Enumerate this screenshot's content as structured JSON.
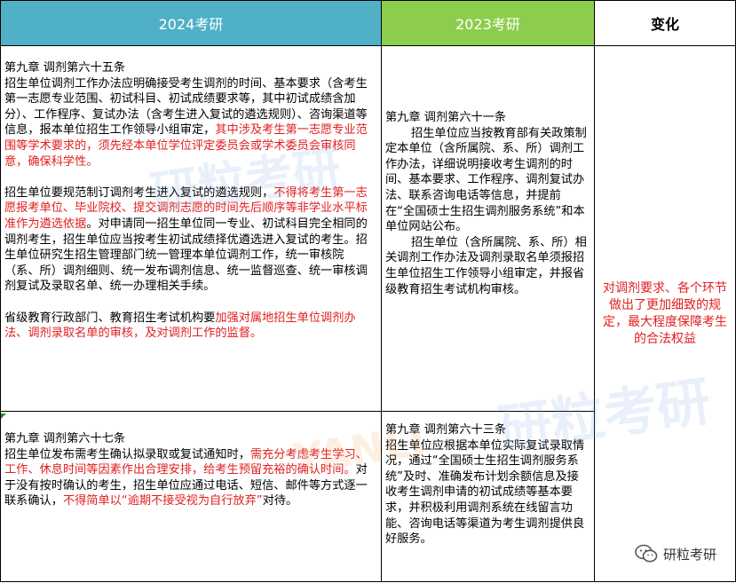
{
  "headers": {
    "col1": "2024考研",
    "col2": "2023考研",
    "col3": "变化"
  },
  "row1": {
    "left": {
      "title": "第九章 调剂第六十五条",
      "p1_plain": "招生单位调剂工作办法应明确接受考生调剂的时间、基本要求（含考生第一志愿专业范围、初试科目、初试成绩要求等，其中初试成绩含加分）、工作程序、复试办法（含考生进入复试的遴选规则）、咨询渠道等信息，报本单位招生工作领导小组审定，",
      "p1_red": "其中涉及考生第一志愿专业范围等学术要求的，须先经本单位学位评定委员会或学术委员会审核同意，确保科学性。",
      "p2_plain_a": "招生单位要规范制订调剂考生进入复试的遴选规则，",
      "p2_red": "不得将考生第一志愿报考单位、毕业院校、提交调剂志愿的时间先后顺序等非学业水平标准作为遴选依据",
      "p2_plain_b": "。对申请同一招生单位同一专业、初试科目完全相同的调剂考生，招生单位应当按考生初试成绩择优遴选进入复试的考生。招生单位研究生招生管理部门统一管理本单位调剂工作，统一审核院（系、所）调剂细则、统一发布调剂信息、统一监督巡查、统一审核调剂复试及录取名单、统一办理相关手续。",
      "p3_plain": "省级教育行政部门、教育招生考试机构要",
      "p3_red": "加强对属地招生单位调剂办法、调剂录取名单的审核，及对调剂工作的监督。"
    },
    "right": {
      "title": "第九章 调剂第六十一条",
      "p1": "招生单位应当按教育部有关政策制定本单位（含所属院、系、所）调剂工作办法，详细说明接收考生调剂的时间、基本要求、工作程序、调剂复试办法、联系咨询电话等信息，并提前在“全国硕士生招生调剂服务系统”和本单位网站公布。",
      "p2": "招生单位（含所属院、系、所）相关调剂工作办法及调剂录取名单须报招生单位招生工作领导小组审定，并报省级教育招生考试机构审核。"
    },
    "change": "对调剂要求、各个环节做出了更加细致的规定，最大程度保障考生的合法权益"
  },
  "row2": {
    "left": {
      "title": "第九章 调剂第六十七条",
      "p1_plain_a": "招生单位发布需考生确认拟录取或复试通知时，",
      "p1_red": "需充分考虑考生学习、工作、休息时间等因素作出合理安排，给考生预留充裕的确认时间。",
      "p1_plain_b": "对于没有按时确认的考生，招生单位应通过电话、短信、邮件等方式逐一联系确认，",
      "p1_red2": "不得简单以“逾期不接受视为自行放弃”",
      "p1_plain_c": "对待。"
    },
    "right": {
      "title": "第九章 调剂第六十三条",
      "p1": "招生单位应根据本单位实际复试录取情况，通过“全国硕士生招生调剂服务系统”及时、准确发布计划余额信息及接收考生调剂申请的初试成绩等基本要求，并积极利用调剂系统在线留言功能、咨询电话等渠道为考生调剂提供良好服务。"
    }
  },
  "watermark": {
    "text_a": "研粒考研",
    "text_b": "研粒考研",
    "text_c": "YANLI"
  },
  "wechat": {
    "icon": "wechat-icon",
    "label": "研粒考研"
  },
  "colors": {
    "header1": "#4fb0c6",
    "header2": "#8dcd4e",
    "highlight": "#e02020"
  }
}
